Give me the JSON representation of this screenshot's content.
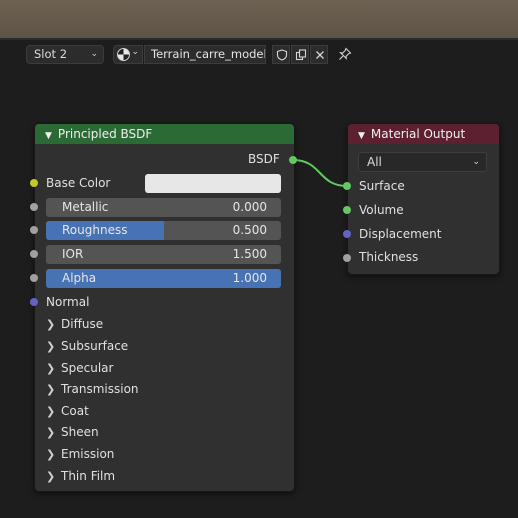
{
  "header": {
    "slot": "Slot 2",
    "material_name": "Terrain_carre_modele"
  },
  "bsdf_node": {
    "title": "Principled BSDF",
    "output_label": "BSDF",
    "base_color_label": "Base Color",
    "base_color_value": "#e7e7e7",
    "fields": [
      {
        "label": "Metallic",
        "value": "0.000",
        "fill": 0.0
      },
      {
        "label": "Roughness",
        "value": "0.500",
        "fill": 0.5
      },
      {
        "label": "IOR",
        "value": "1.500",
        "fill": 0.0
      },
      {
        "label": "Alpha",
        "value": "1.000",
        "fill": 1.0
      }
    ],
    "normal_label": "Normal",
    "panels": [
      "Diffuse",
      "Subsurface",
      "Specular",
      "Transmission",
      "Coat",
      "Sheen",
      "Emission",
      "Thin Film"
    ]
  },
  "output_node": {
    "title": "Material Output",
    "target": "All",
    "inputs": [
      "Surface",
      "Volume",
      "Displacement",
      "Thickness"
    ]
  },
  "colors": {
    "bsdf_header": "#2b6a35",
    "output_header": "#5c2030",
    "socket_color": "#c7c729",
    "socket_shader": "#63c763",
    "socket_float": "#a1a1a1",
    "socket_vector": "#6363c7",
    "slider_fill": "#4772b3"
  },
  "icons": [
    "chevron-down-icon",
    "material-sphere-icon",
    "fake-user-shield-icon",
    "duplicate-icon",
    "close-icon",
    "pin-icon",
    "chevron-right-icon"
  ]
}
